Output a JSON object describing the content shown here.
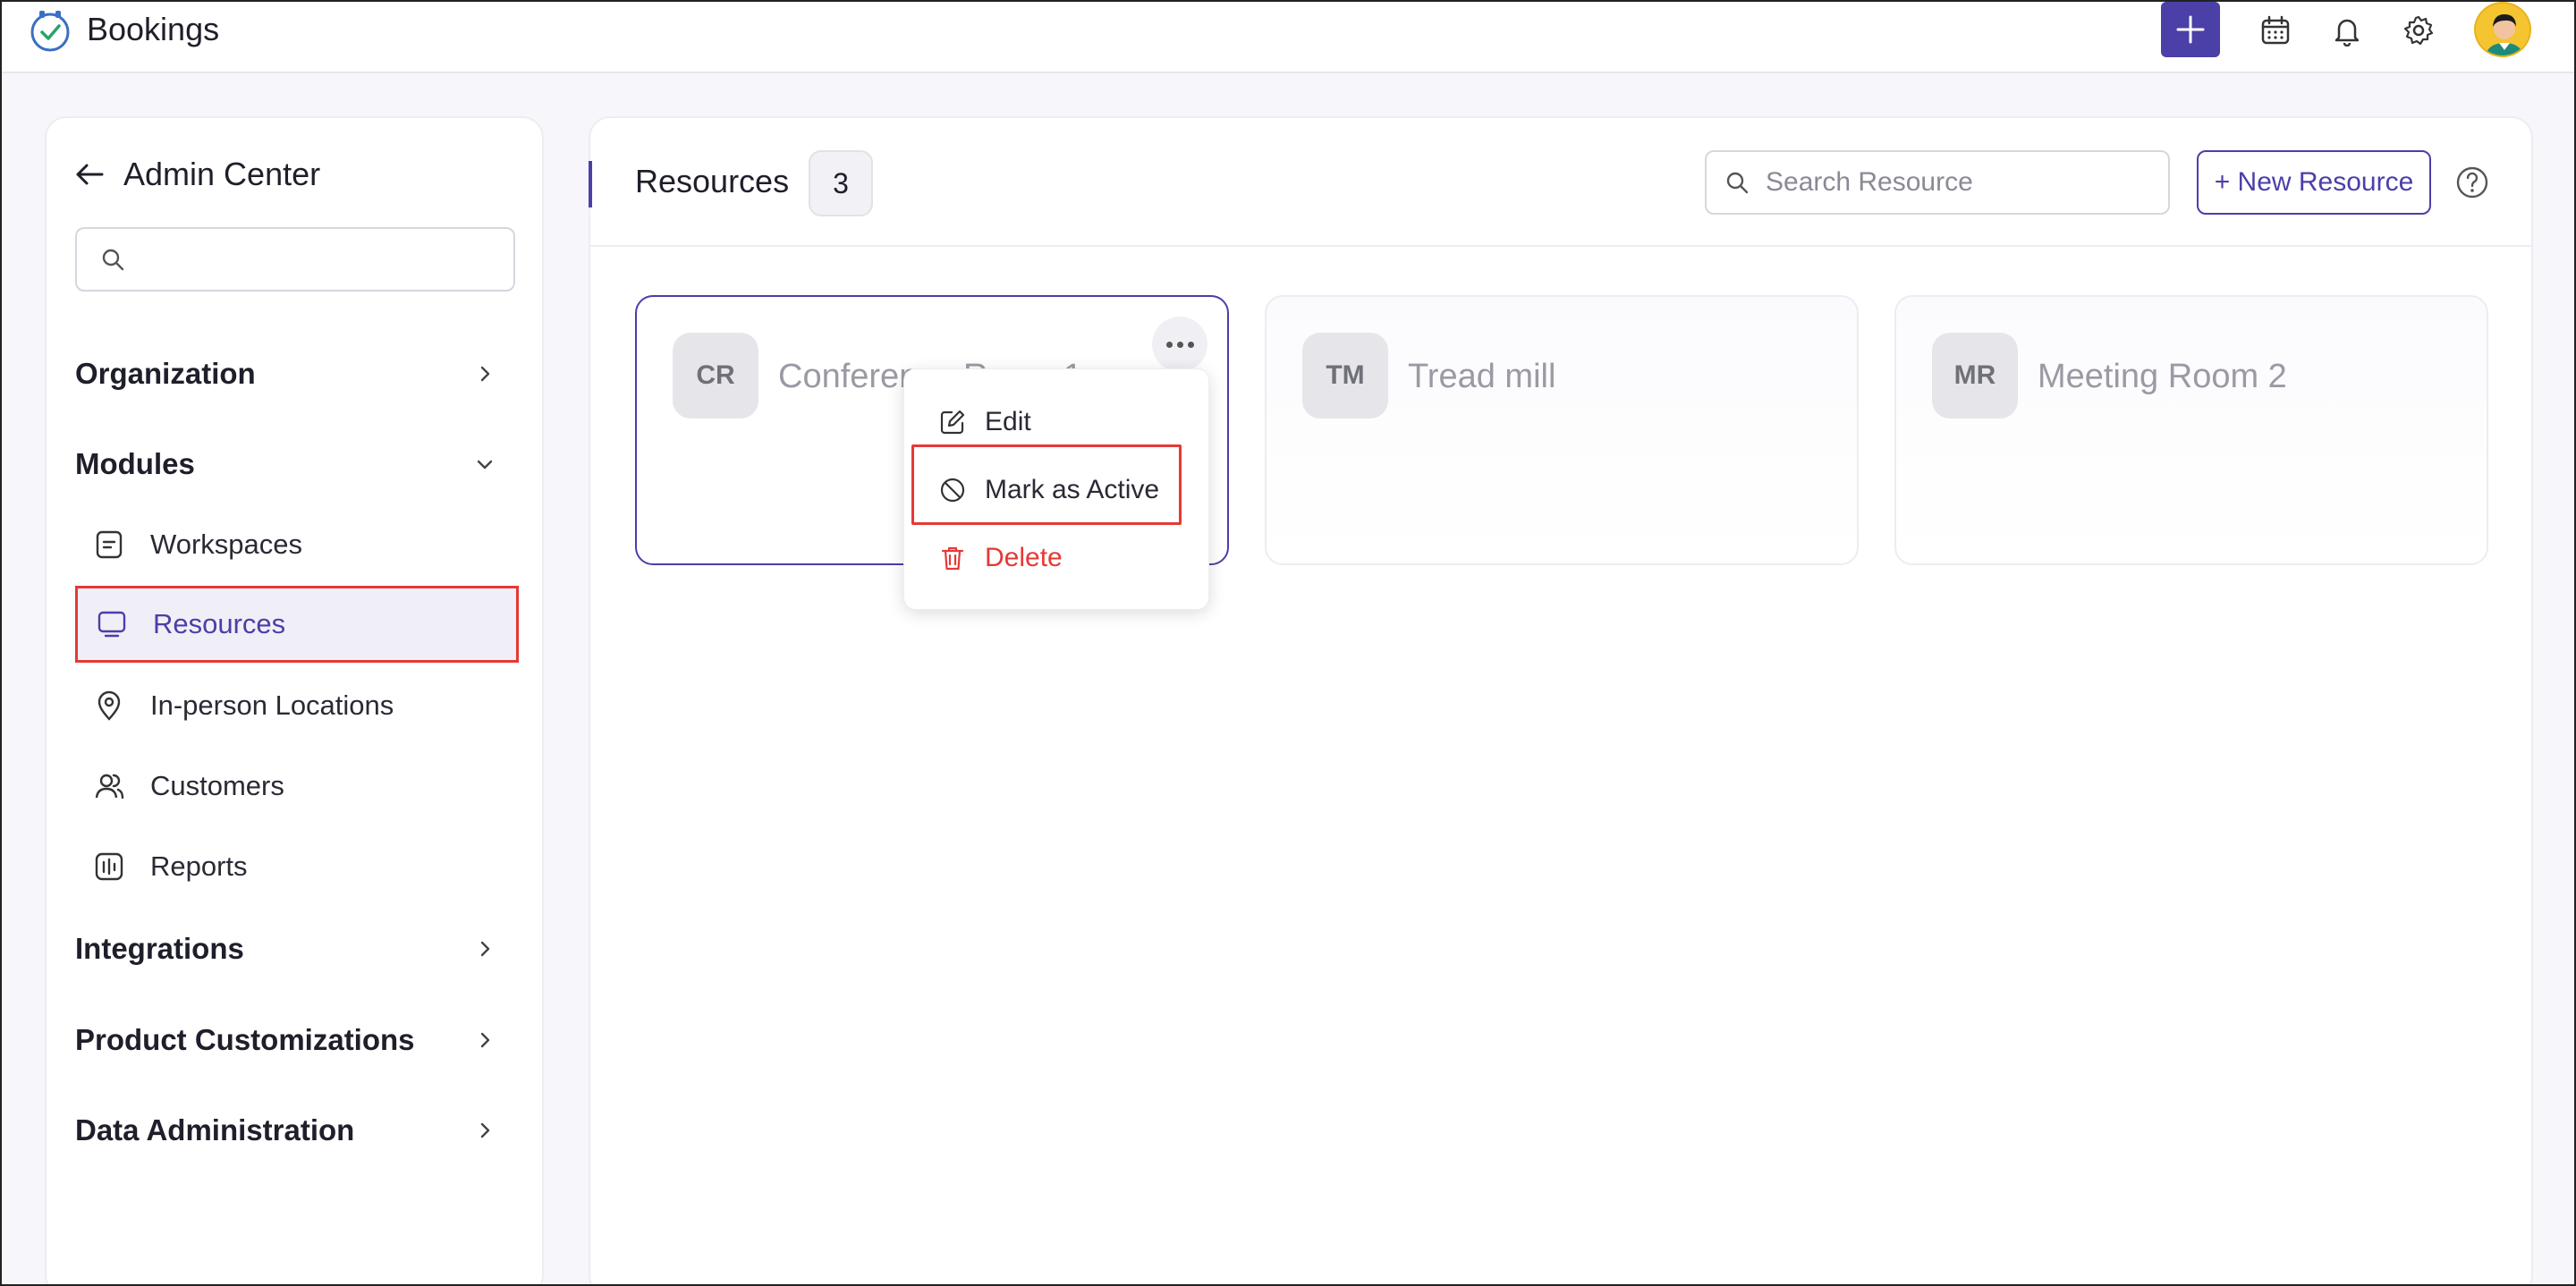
{
  "app": {
    "title": "Bookings"
  },
  "topbar": {
    "icons": [
      "plus-icon",
      "calendar-icon",
      "bell-icon",
      "gear-icon",
      "user-avatar"
    ]
  },
  "sidebar": {
    "title": "Admin Center",
    "search_placeholder": "",
    "sections": {
      "organization": "Organization",
      "modules": "Modules",
      "integrations": "Integrations",
      "product_customizations": "Product Customizations",
      "data_administration": "Data Administration"
    },
    "module_items": [
      {
        "label": "Workspaces",
        "icon": "document-icon"
      },
      {
        "label": "Resources",
        "icon": "monitor-icon",
        "active": true
      },
      {
        "label": "In-person Locations",
        "icon": "location-pin-icon"
      },
      {
        "label": "Customers",
        "icon": "users-icon"
      },
      {
        "label": "Reports",
        "icon": "report-icon"
      }
    ]
  },
  "main": {
    "title": "Resources",
    "count": "3",
    "search_placeholder": "Search Resource",
    "new_button": "+ New Resource",
    "cards": [
      {
        "initials": "CR",
        "name": "Conference Room 1"
      },
      {
        "initials": "TM",
        "name": "Tread mill"
      },
      {
        "initials": "MR",
        "name": "Meeting Room 2"
      }
    ]
  },
  "context_menu": {
    "items": [
      {
        "label": "Edit",
        "icon": "edit-icon"
      },
      {
        "label": "Mark as Active",
        "icon": "ban-icon"
      },
      {
        "label": "Delete",
        "icon": "trash-icon"
      }
    ]
  },
  "colors": {
    "accent": "#4b3fa8",
    "danger": "#e53935"
  }
}
